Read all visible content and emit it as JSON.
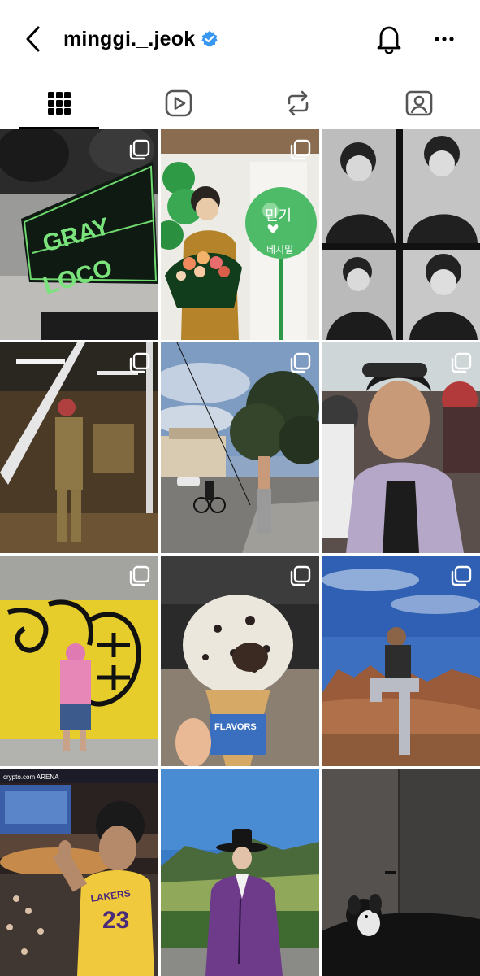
{
  "header": {
    "username": "minggi._.jeok",
    "verified": true,
    "back_icon": "chevron-left-icon",
    "notification_icon": "bell-icon",
    "more_icon": "ellipsis-icon",
    "verified_color": "#3897f0"
  },
  "tabs": [
    {
      "id": "posts",
      "icon": "grid-icon",
      "active": true
    },
    {
      "id": "reels",
      "icon": "reels-icon",
      "active": false
    },
    {
      "id": "reposts",
      "icon": "repost-icon",
      "active": false
    },
    {
      "id": "tagged",
      "icon": "tagged-icon",
      "active": false
    }
  ],
  "posts": [
    {
      "desc": "GRAY LOCO banner",
      "multi": true,
      "banner_line1": "GRAY",
      "banner_line2": "LOCO"
    },
    {
      "desc": "man with bouquet and balloon",
      "multi": true,
      "balloon_text1": "민기",
      "balloon_text2": "베지밀"
    },
    {
      "desc": "black and white photo booth strip",
      "multi": false
    },
    {
      "desc": "reflection in glass window",
      "multi": true
    },
    {
      "desc": "street with cyclist",
      "multi": true
    },
    {
      "desc": "selfie with sunglasses on head",
      "multi": true
    },
    {
      "desc": "yellow graffiti wall",
      "multi": true
    },
    {
      "desc": "cookies and cream ice cream cone",
      "multi": true,
      "cone_text": "FLAVORS"
    },
    {
      "desc": "man sitting on rock in desert",
      "multi": true
    },
    {
      "desc": "arena selfie in Lakers jersey",
      "multi": false,
      "arena_text": "crypto.com ARENA",
      "jersey_text": "LAKERS",
      "jersey_number": "23"
    },
    {
      "desc": "man in purple hanbok with gat",
      "multi": false
    },
    {
      "desc": "dark room with small dog",
      "multi": false
    }
  ]
}
